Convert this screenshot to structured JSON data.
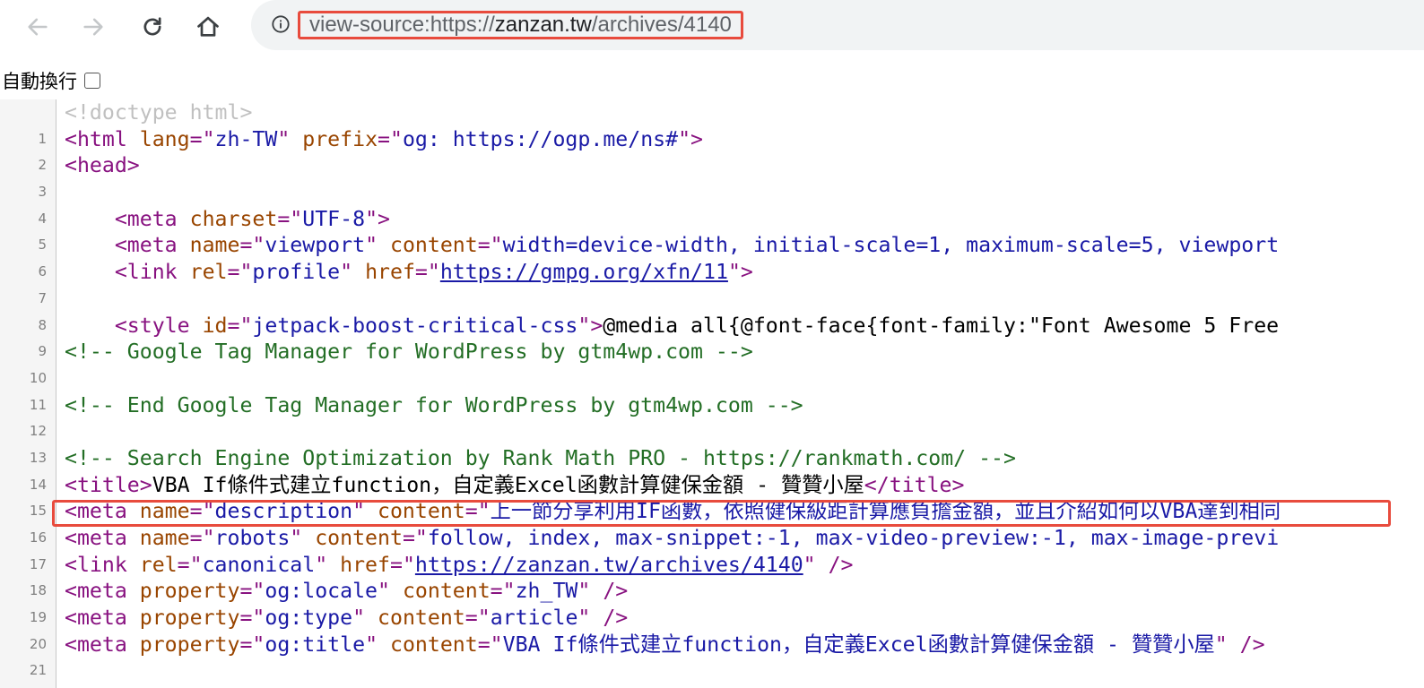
{
  "toolbar": {
    "back_icon": "arrow-left-icon",
    "forward_icon": "arrow-right-icon",
    "reload_icon": "reload-icon",
    "home_icon": "home-icon",
    "info_icon": "info-icon",
    "url_scheme": "view-source:https://",
    "url_host": "zanzan.tw",
    "url_path": "/archives/4140"
  },
  "wrap_toggle": {
    "label": "自動換行",
    "checked": false
  },
  "source": {
    "line_numbers": [
      "1",
      "2",
      "3",
      "4",
      "5",
      "6",
      "7",
      "8",
      "9",
      "10",
      "11",
      "12",
      "13",
      "14",
      "15",
      "16",
      "17",
      "18",
      "19",
      "20",
      "21"
    ],
    "l1": "<!doctype html>",
    "l2": {
      "open": "<html ",
      "lang_attr": "lang",
      "eq_q1": "=\"",
      "lang_val": "zh-TW",
      "q_sp": "\" ",
      "prefix_attr": "prefix",
      "eq_q2": "=\"",
      "prefix_val": "og: https://ogp.me/ns#",
      "close": "\">"
    },
    "l3": "<head>",
    "l5": {
      "open": "    <meta ",
      "attr": "charset",
      "eq": "=\"",
      "val": "UTF-8",
      "close": "\">"
    },
    "l6": {
      "open": "    <meta ",
      "attr1": "name",
      "eq1": "=\"",
      "val1": "viewport",
      "mid": "\" ",
      "attr2": "content",
      "eq2": "=\"",
      "val2": "width=device-width, initial-scale=1, maximum-scale=5, viewport"
    },
    "l7": {
      "open": "    <link ",
      "attr1": "rel",
      "eq1": "=\"",
      "val1": "profile",
      "mid": "\" ",
      "attr2": "href",
      "eq2": "=\"",
      "link": "https://gmpg.org/xfn/11",
      "close": "\">"
    },
    "l9": {
      "open": "    <style ",
      "attr": "id",
      "eq": "=\"",
      "val": "jetpack-boost-critical-css",
      "close": "\">",
      "text": "@media all{@font-face{font-family:\"Font Awesome 5 Free"
    },
    "l10": "<!-- Google Tag Manager for WordPress by gtm4wp.com -->",
    "l12": "<!-- End Google Tag Manager for WordPress by gtm4wp.com -->",
    "l14": "<!-- Search Engine Optimization by Rank Math PRO - https://rankmath.com/ -->",
    "l15": {
      "open": "<title>",
      "text": "VBA If條件式建立function，自定義Excel函數計算健保金額 - 贊贊小屋",
      "close": "</title>"
    },
    "l16": {
      "open": "<meta ",
      "attr1": "name",
      "eq1": "=\"",
      "val1": "description",
      "mid": "\" ",
      "attr2": "content",
      "eq2": "=\"",
      "val2": "上一節分享利用IF函數，依照健保級距計算應負擔金額，並且介紹如何以VBA達到相同"
    },
    "l17": {
      "open": "<meta ",
      "attr1": "name",
      "eq1": "=\"",
      "val1": "robots",
      "mid": "\" ",
      "attr2": "content",
      "eq2": "=\"",
      "val2": "follow, index, max-snippet:-1, max-video-preview:-1, max-image-previ"
    },
    "l18": {
      "open": "<link ",
      "attr1": "rel",
      "eq1": "=\"",
      "val1": "canonical",
      "mid": "\" ",
      "attr2": "href",
      "eq2": "=\"",
      "link": "https://zanzan.tw/archives/4140",
      "close": "\" />"
    },
    "l19": {
      "open": "<meta ",
      "attr1": "property",
      "eq1": "=\"",
      "val1": "og:locale",
      "mid": "\" ",
      "attr2": "content",
      "eq2": "=\"",
      "val2": "zh_TW",
      "close": "\" />"
    },
    "l20": {
      "open": "<meta ",
      "attr1": "property",
      "eq1": "=\"",
      "val1": "og:type",
      "mid": "\" ",
      "attr2": "content",
      "eq2": "=\"",
      "val2": "article",
      "close": "\" />"
    },
    "l21": {
      "open": "<meta ",
      "attr1": "property",
      "eq1": "=\"",
      "val1": "og:title",
      "mid": "\" ",
      "attr2": "content",
      "eq2": "=\"",
      "val2": "VBA If條件式建立function，自定義Excel函數計算健保金額 - 贊贊小屋",
      "close": "\" />"
    }
  },
  "colors": {
    "tag": "#881280",
    "attr": "#994500",
    "value": "#1a1aa6",
    "comment": "#236e25",
    "doctype": "#c0c0c0",
    "highlight_border": "#e84b3d"
  }
}
